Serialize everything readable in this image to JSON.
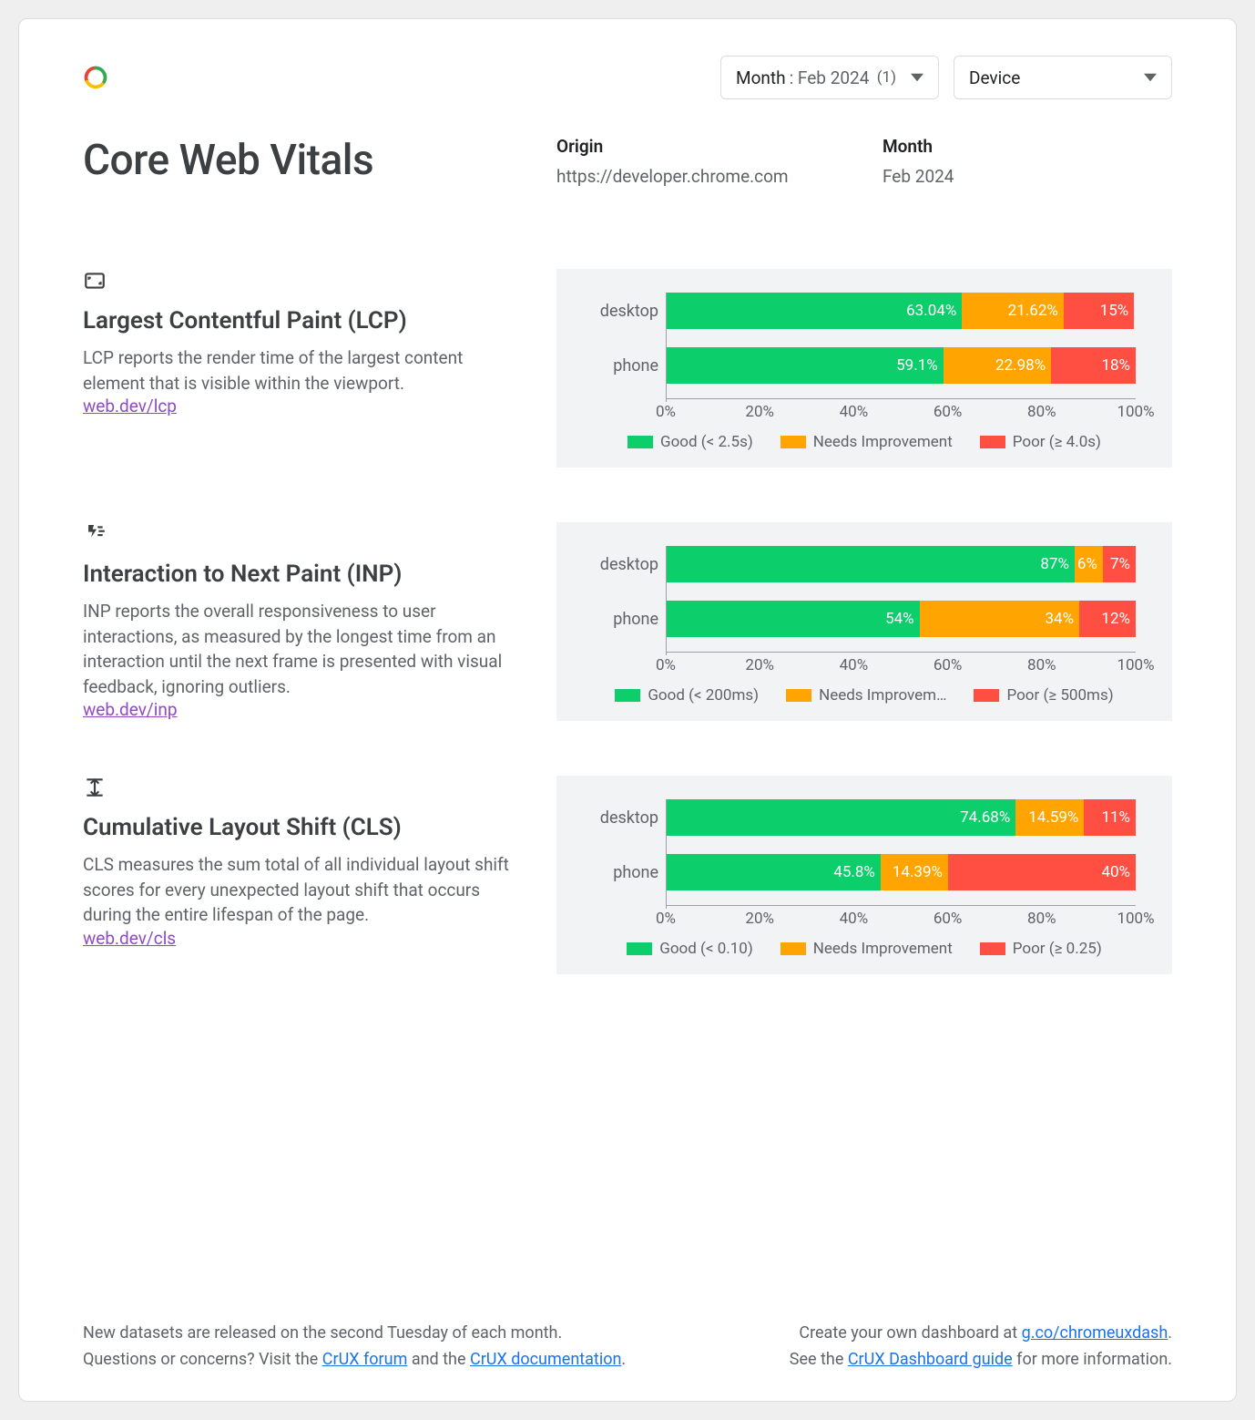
{
  "controls": {
    "month_label": "Month",
    "month_value": ": Feb 2024",
    "month_count": "(1)",
    "device_label": "Device"
  },
  "header": {
    "title": "Core Web Vitals",
    "origin_label": "Origin",
    "origin_value": "https://developer.chrome.com",
    "month_label": "Month",
    "month_value": "Feb 2024"
  },
  "metrics": [
    {
      "id": "lcp",
      "title": "Largest Contentful Paint (LCP)",
      "desc": "LCP reports the render time of the largest content element that is visible within the viewport.",
      "link_text": "web.dev/lcp",
      "legend": {
        "good": "Good (< 2.5s)",
        "ni": "Needs Improvement",
        "poor": "Poor (≥ 4.0s)"
      },
      "rows": [
        {
          "label": "desktop",
          "good": 63.04,
          "ni": 21.62,
          "poor": 15,
          "good_txt": "63.04%",
          "ni_txt": "21.62%",
          "poor_txt": "15%"
        },
        {
          "label": "phone",
          "good": 59.1,
          "ni": 22.98,
          "poor": 18,
          "good_txt": "59.1%",
          "ni_txt": "22.98%",
          "poor_txt": "18%"
        }
      ]
    },
    {
      "id": "inp",
      "title": "Interaction to Next Paint (INP)",
      "desc": "INP reports the overall responsiveness to user interactions, as measured by the longest time from an interaction until the next frame is presented with visual feedback, ignoring outliers.",
      "link_text": "web.dev/inp",
      "legend": {
        "good": "Good (< 200ms)",
        "ni": "Needs Improvem…",
        "poor": "Poor (≥ 500ms)"
      },
      "rows": [
        {
          "label": "desktop",
          "good": 87,
          "ni": 6,
          "poor": 7,
          "good_txt": "87%",
          "ni_txt": "6%",
          "poor_txt": "7%"
        },
        {
          "label": "phone",
          "good": 54,
          "ni": 34,
          "poor": 12,
          "good_txt": "54%",
          "ni_txt": "34%",
          "poor_txt": "12%"
        }
      ]
    },
    {
      "id": "cls",
      "title": "Cumulative Layout Shift (CLS)",
      "desc": "CLS measures the sum total of all individual layout shift scores for every unexpected layout shift that occurs during the entire lifespan of the page.",
      "link_text": "web.dev/cls",
      "legend": {
        "good": "Good (< 0.10)",
        "ni": "Needs Improvement",
        "poor": "Poor (≥ 0.25)"
      },
      "rows": [
        {
          "label": "desktop",
          "good": 74.68,
          "ni": 14.59,
          "poor": 11,
          "good_txt": "74.68%",
          "ni_txt": "14.59%",
          "poor_txt": "11%"
        },
        {
          "label": "phone",
          "good": 45.8,
          "ni": 14.39,
          "poor": 40,
          "good_txt": "45.8%",
          "ni_txt": "14.39%",
          "poor_txt": "40%"
        }
      ]
    }
  ],
  "xaxis": [
    "0%",
    "20%",
    "40%",
    "60%",
    "80%",
    "100%"
  ],
  "footer": {
    "l1": "New datasets are released on the second Tuesday of each month.",
    "l2a": "Questions or concerns? Visit the ",
    "l2_link1": "CrUX forum",
    "l2b": " and the ",
    "l2_link2": "CrUX documentation",
    "l2c": ".",
    "r1a": "Create your own dashboard at ",
    "r1_link": "g.co/chromeuxdash",
    "r1b": ".",
    "r2a": "See the ",
    "r2_link": "CrUX Dashboard guide",
    "r2b": " for more information."
  },
  "chart_data": [
    {
      "type": "bar",
      "orientation": "horizontal-stacked",
      "title": "Largest Contentful Paint (LCP)",
      "categories": [
        "desktop",
        "phone"
      ],
      "xlim": [
        0,
        100
      ],
      "xlabel": "%",
      "series": [
        {
          "name": "Good (< 2.5s)",
          "values": [
            63.04,
            59.1
          ]
        },
        {
          "name": "Needs Improvement",
          "values": [
            21.62,
            22.98
          ]
        },
        {
          "name": "Poor (≥ 4.0s)",
          "values": [
            15,
            18
          ]
        }
      ]
    },
    {
      "type": "bar",
      "orientation": "horizontal-stacked",
      "title": "Interaction to Next Paint (INP)",
      "categories": [
        "desktop",
        "phone"
      ],
      "xlim": [
        0,
        100
      ],
      "xlabel": "%",
      "series": [
        {
          "name": "Good (< 200ms)",
          "values": [
            87,
            54
          ]
        },
        {
          "name": "Needs Improvement",
          "values": [
            6,
            34
          ]
        },
        {
          "name": "Poor (≥ 500ms)",
          "values": [
            7,
            12
          ]
        }
      ]
    },
    {
      "type": "bar",
      "orientation": "horizontal-stacked",
      "title": "Cumulative Layout Shift (CLS)",
      "categories": [
        "desktop",
        "phone"
      ],
      "xlim": [
        0,
        100
      ],
      "xlabel": "%",
      "series": [
        {
          "name": "Good (< 0.10)",
          "values": [
            74.68,
            45.8
          ]
        },
        {
          "name": "Needs Improvement",
          "values": [
            14.59,
            14.39
          ]
        },
        {
          "name": "Poor (≥ 0.25)",
          "values": [
            11,
            40
          ]
        }
      ]
    }
  ]
}
